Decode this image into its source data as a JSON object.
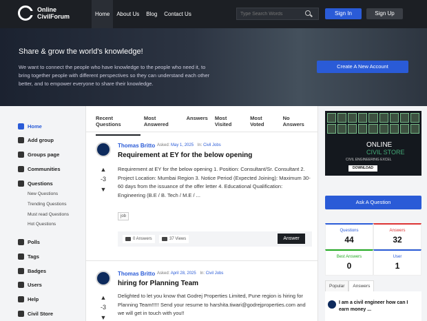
{
  "header": {
    "logo_line1": "Online",
    "logo_line2": "CivilForum",
    "nav": [
      "Home",
      "About Us",
      "Blog",
      "Contact Us"
    ],
    "search_placeholder": "Type Search Words",
    "signin": "Sign In",
    "signup": "Sign Up"
  },
  "hero": {
    "title": "Share & grow the world's knowledge!",
    "text": "We want to connect the people who have knowledge to the people who need it, to bring together people with different perspectives so they can understand each other better, and to empower everyone to share their knowledge.",
    "button": "Create A New Account"
  },
  "sidebar": {
    "items": [
      {
        "label": "Home",
        "icon": "home-icon"
      },
      {
        "label": "Add group",
        "icon": "add-group-icon"
      },
      {
        "label": "Groups page",
        "icon": "groups-icon"
      },
      {
        "label": "Communities",
        "icon": "communities-icon"
      },
      {
        "label": "Questions",
        "icon": "questions-icon"
      },
      {
        "label": "Polls",
        "icon": "polls-icon"
      },
      {
        "label": "Tags",
        "icon": "tags-icon"
      },
      {
        "label": "Badges",
        "icon": "badges-icon"
      },
      {
        "label": "Users",
        "icon": "users-icon"
      },
      {
        "label": "Help",
        "icon": "help-icon"
      },
      {
        "label": "Civil Store",
        "icon": "store-icon"
      }
    ],
    "sub": [
      "New Questions",
      "Trending Questions",
      "Must read Questions",
      "Hot Questions"
    ]
  },
  "main": {
    "tabs": [
      "Recent Questions",
      "Most Answered",
      "Answers",
      "Most Visited",
      "Most Voted",
      "No Answers"
    ],
    "questions": [
      {
        "author": "Thomas Britto",
        "asked_label": "Asked:",
        "date": "May 1, 2025",
        "in_label": "In:",
        "category": "Civil Jobs",
        "title": "Requirement at EY for the below opening",
        "body": "Requirement at EY for the below opening   1. Position: Consultant/Sr. Consultant 2. Project Location: Mumbai Region 3. Notice Period (Expected Joining): Maximum 30-60 days from the issuance of the offer letter 4. Educational Qualification: Engineering (B.E / B. Tech / M.E / ...",
        "votes": "-3",
        "tag": "job",
        "answers": "0 Answers",
        "views": "37 Views",
        "answer_btn": "Answer"
      },
      {
        "author": "Thomas Britto",
        "asked_label": "Asked:",
        "date": "April 28, 2025",
        "in_label": "In:",
        "category": "Civil Jobs",
        "title": "hiring for Planning Team",
        "body": "Delighted to let you know that Godrej Properties Limited, Pune region is hiring for Planning Team!!!!!     Send your resume to harshita.tiwari@godrejproperties.com and we will get in touch with you!!",
        "votes": "-3"
      }
    ]
  },
  "right": {
    "ad_title1": "ONLINE",
    "ad_title2": "CIVIL STORE",
    "ad_sub": "CIVIL ENGINEERING EXCEL",
    "ad_btn": "DOWNLOAD",
    "ask_btn": "Ask A Question",
    "stats": [
      {
        "label": "Questions",
        "value": "44"
      },
      {
        "label": "Answers",
        "value": "32"
      },
      {
        "label": "Best Answers",
        "value": "0"
      },
      {
        "label": "User",
        "value": "1"
      }
    ],
    "tabs": [
      "Popular",
      "Answers"
    ],
    "popular_first": "I am a civil engineer how can I earn money ..."
  }
}
